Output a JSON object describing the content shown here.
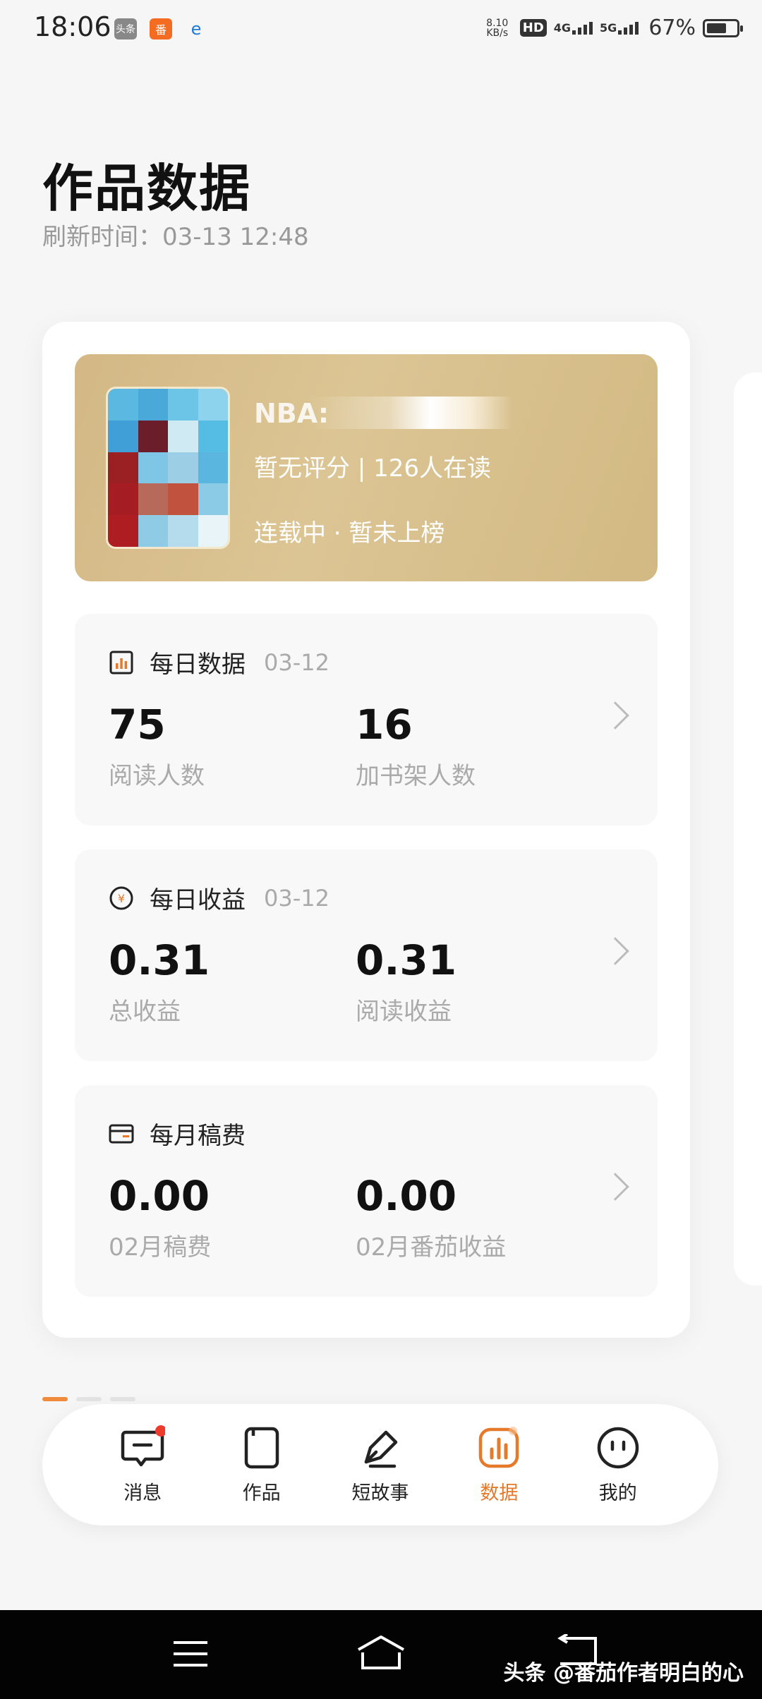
{
  "status_bar": {
    "time": "18:06",
    "app_icon_1": "头条",
    "app_icon_2": "番",
    "telecom": "e",
    "speed_top": "8.10",
    "speed_bottom": "KB/s",
    "hd": "HD",
    "net_4g": "4G",
    "net_5g": "5G",
    "battery": "67%",
    "battery_level": 0.67
  },
  "header": {
    "title": "作品数据",
    "refresh": "刷新时间：03-13 12:48"
  },
  "book": {
    "name": "NBA:",
    "meta": "暂无评分 | 126人在读",
    "status": "连载中 · 暂未上榜"
  },
  "daily_data": {
    "title": "每日数据",
    "date": "03-12",
    "value1": "75",
    "label1": "阅读人数",
    "value2": "16",
    "label2": "加书架人数"
  },
  "daily_income": {
    "title": "每日收益",
    "date": "03-12",
    "value1": "0.31",
    "label1": "总收益",
    "value2": "0.31",
    "label2": "阅读收益"
  },
  "monthly_fee": {
    "title": "每月稿费",
    "value1": "0.00",
    "label1": "02月稿费",
    "value2": "0.00",
    "label2": "02月番茄收益"
  },
  "nav": {
    "messages": "消息",
    "works": "作品",
    "short_story": "短故事",
    "data": "数据",
    "me": "我的"
  },
  "colors": {
    "accent": "#e57a2a",
    "card_gold": "#d8bf8c"
  },
  "watermark": "头条 @番茄作者明白的心"
}
